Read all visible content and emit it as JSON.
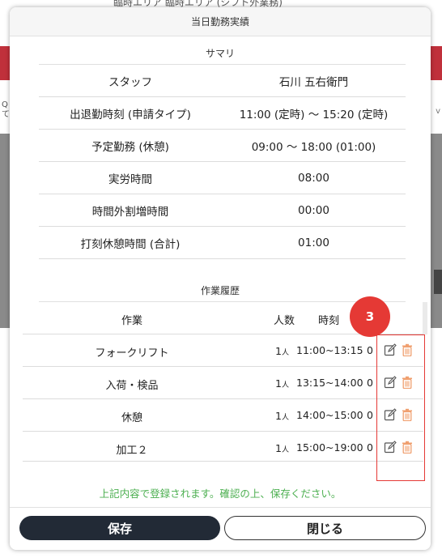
{
  "background": {
    "top_text": "臨時エリア  臨時エリア  (シフト外業務)",
    "side_left": "Q\nて",
    "side_right": "v"
  },
  "modal": {
    "title": "当日勤務実績",
    "summary": {
      "title": "サマリ",
      "rows": [
        {
          "label": "スタッフ",
          "value": "石川 五右衛門"
        },
        {
          "label": "出退勤時刻 (申請タイプ)",
          "value": "11:00 (定時) 〜 15:20 (定時)"
        },
        {
          "label": "予定勤務 (休憩)",
          "value": "09:00 〜 18:00 (01:00)"
        },
        {
          "label": "実労時間",
          "value": "08:00"
        },
        {
          "label": "時間外割増時間",
          "value": "00:00"
        },
        {
          "label": "打刻休憩時間 (合計)",
          "value": "01:00"
        }
      ]
    },
    "work_history": {
      "title": "作業履歴",
      "columns": {
        "task": "作業",
        "people": "人数",
        "time": "時刻"
      },
      "rows": [
        {
          "task": "フォークリフト",
          "people": "1",
          "unit": "人",
          "time": "11:00~13:15",
          "extra": "0"
        },
        {
          "task": "入荷・検品",
          "people": "1",
          "unit": "人",
          "time": "13:15~14:00",
          "extra": "0"
        },
        {
          "task": "休憩",
          "people": "1",
          "unit": "人",
          "time": "14:00~15:00",
          "extra": "0"
        },
        {
          "task": "加工２",
          "people": "1",
          "unit": "人",
          "time": "15:00~19:00",
          "extra": "0"
        }
      ]
    },
    "annotation_badge": "3",
    "notice": "上記内容で登録されます。確認の上、保存ください。",
    "buttons": {
      "save": "保存",
      "close": "閉じる"
    }
  },
  "colors": {
    "accent_red": "#e53935",
    "notice_green": "#4caf50",
    "save_button": "#222a36",
    "edit_icon": "#555555",
    "trash_icon": "#f0a070"
  }
}
